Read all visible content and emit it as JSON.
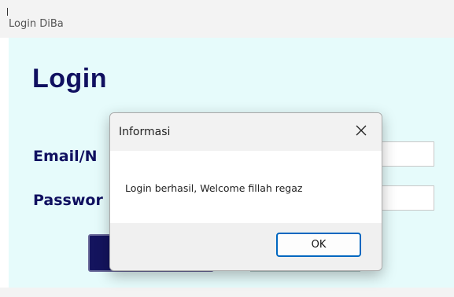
{
  "window": {
    "title": "Login DiBa"
  },
  "form": {
    "heading": "Login",
    "email_label": "Email/N",
    "password_label": "Passwor",
    "email_value": "",
    "password_value": ""
  },
  "dialog": {
    "title": "Informasi",
    "close_icon": "close-icon",
    "message": "Login berhasil, Welcome fillah regaz",
    "ok_label": "OK"
  },
  "colors": {
    "form_background": "#e6fbfb",
    "heading_color": "#101060",
    "login_button": "#14145e",
    "ok_border": "#0067c0"
  }
}
